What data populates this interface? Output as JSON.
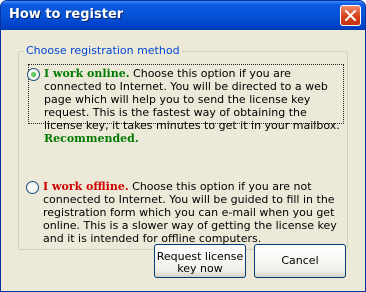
{
  "window": {
    "title": "How to register"
  },
  "group": {
    "legend": "Choose registration method"
  },
  "options": [
    {
      "heading": "I work online.",
      "text": "Choose this option if you are connected to Internet. You will be directed to a web page which will help you to send the license key request. This is the fastest way of obtaining the license key, it takes minutes to get it in your mailbox.",
      "recommended": "Recommended.",
      "selected": true,
      "heading_color": "#007a00"
    },
    {
      "heading": "I work offline.",
      "text": "Choose this option if you are not connected to Internet. You will be guided to fill in the registration form which you can e-mail when you get online. This is a slower way of getting the license key and it is intended for offline computers.",
      "selected": false,
      "heading_color": "#cc0000"
    }
  ],
  "buttons": {
    "request_line1": "Request license",
    "request_line2": "key now",
    "cancel": "Cancel"
  },
  "icons": {
    "close": "close-icon"
  }
}
